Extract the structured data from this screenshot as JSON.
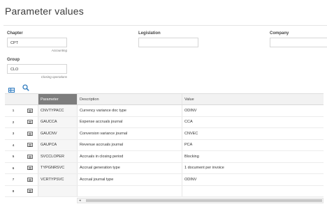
{
  "page": {
    "title": "Parameter values"
  },
  "form": {
    "chapter": {
      "label": "Chapter",
      "value": "CPT",
      "caption": "Accounting"
    },
    "legislation": {
      "label": "Legislation",
      "value": ""
    },
    "company": {
      "label": "Company",
      "value": ""
    },
    "group": {
      "label": "Group",
      "value": "CLO",
      "caption": "Closing operations"
    }
  },
  "toolbar": {
    "icons": [
      "grid-view-icon",
      "search-icon"
    ]
  },
  "grid": {
    "columns": {
      "parameter": "Parameter",
      "description": "Description",
      "value": "Value"
    },
    "rows": [
      {
        "num": "1",
        "parameter": "CNVTYPACC",
        "description": "Currency variance doc type",
        "value": "ODINV"
      },
      {
        "num": "2",
        "parameter": "GAUCCA",
        "description": "Expense accruals journal",
        "value": "CCA"
      },
      {
        "num": "3",
        "parameter": "GAUCNV",
        "description": "Conversion variance journal",
        "value": "CNVEC"
      },
      {
        "num": "4",
        "parameter": "GAUPCA",
        "description": "Revenue accruals journal",
        "value": "PCA"
      },
      {
        "num": "5",
        "parameter": "SVCCLOPER",
        "description": "Accruals in closing period",
        "value": "Blocking"
      },
      {
        "num": "6",
        "parameter": "TYPGNRSVC",
        "description": "Accrual generation type",
        "value": "1 document per invoice"
      },
      {
        "num": "7",
        "parameter": "VCRTYPSVC",
        "description": "Accrual journal type",
        "value": "ODINV"
      },
      {
        "num": "8",
        "parameter": "",
        "description": "",
        "value": ""
      }
    ]
  },
  "scrollbar": {
    "arrow": "◂"
  }
}
